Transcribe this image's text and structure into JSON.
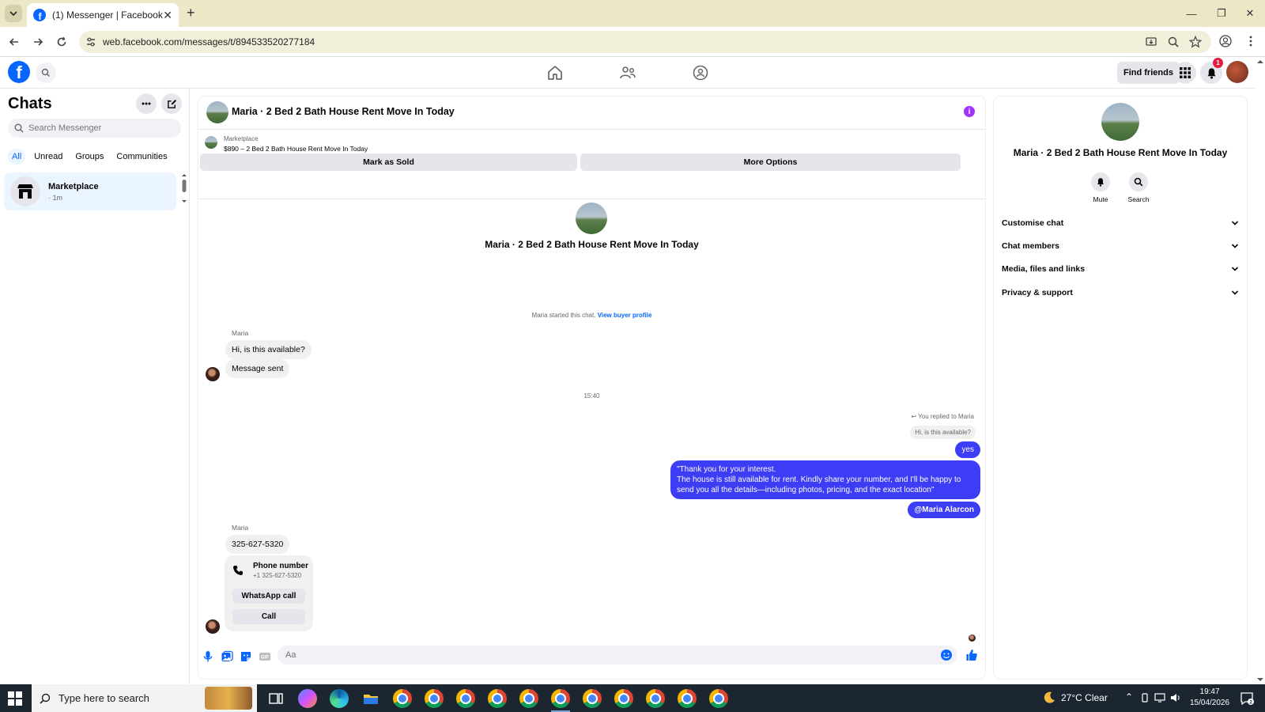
{
  "browser": {
    "tab_title": "(1) Messenger | Facebook",
    "url": "web.facebook.com/messages/t/894533520277184"
  },
  "header": {
    "find_friends": "Find friends",
    "notification_count": "1"
  },
  "sidebar": {
    "title": "Chats",
    "search_placeholder": "Search Messenger",
    "filters": [
      "All",
      "Unread",
      "Groups",
      "Communities"
    ],
    "chat": {
      "name": "Marketplace",
      "time": "· 1m"
    }
  },
  "conversation": {
    "title": "Maria · 2 Bed 2 Bath House Rent Move In Today",
    "marketplace_label": "Marketplace",
    "listing": "$890 – 2 Bed 2 Bath House Rent Move In Today",
    "mark_sold": "Mark as Sold",
    "more_options": "More Options",
    "started_text": "Maria started this chat.",
    "view_buyer": "View buyer profile",
    "sender": "Maria",
    "msg1": "Hi, is this available?",
    "msg2": "Message sent",
    "timestamp": "15:40",
    "replied_to": "You replied to Maria",
    "quoted": "Hi, is this available?",
    "reply_yes": "yes",
    "reply_long_1": "\"Thank you for your interest.",
    "reply_long_2": "The house is still available for rent. Kindly share your number, and I'll be happy to",
    "reply_long_3": "send you all the details—including photos, pricing, and the exact location\"",
    "mention": "@Maria Alarcon",
    "msg3": "325-627-5320",
    "phone_title": "Phone number",
    "phone_number": "+1 325-627-5320",
    "whatsapp": "WhatsApp call",
    "call": "Call",
    "composer_placeholder": "Aa"
  },
  "right_panel": {
    "title": "Maria · 2 Bed 2 Bath House Rent Move In Today",
    "mute": "Mute",
    "search": "Search",
    "rows": [
      "Customise chat",
      "Chat members",
      "Media, files and links",
      "Privacy & support"
    ]
  },
  "taskbar": {
    "search_placeholder": "Type here to search",
    "weather": "27°C  Clear",
    "time": "19:47",
    "date": "15/04/2026"
  },
  "colors": {
    "brand": "#0866ff",
    "outgoing": "#3d3df5",
    "accent_purple": "#a033ff"
  }
}
